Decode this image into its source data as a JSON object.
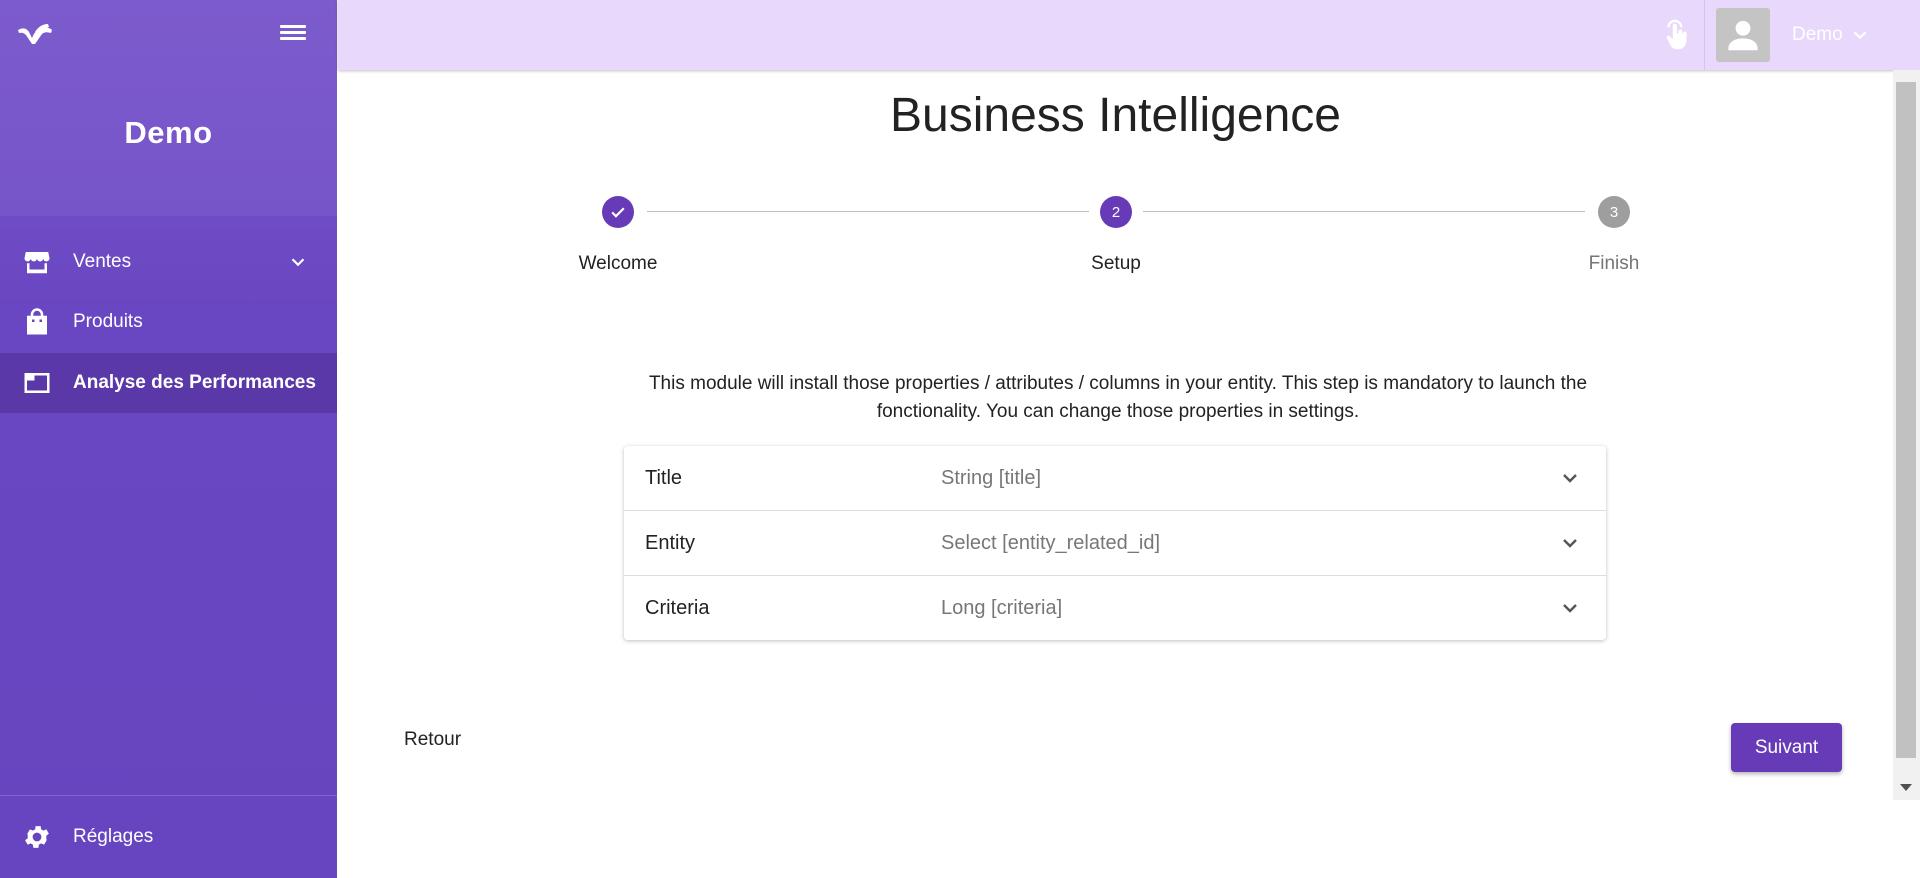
{
  "sidebar": {
    "brand": "Demo",
    "items": [
      {
        "label": "Ventes"
      },
      {
        "label": "Produits"
      },
      {
        "label": "Analyse des Performances"
      }
    ],
    "settings_label": "Réglages"
  },
  "topbar": {
    "user_name": "Demo"
  },
  "main": {
    "title": "Business Intelligence",
    "steps": [
      {
        "number": "1",
        "label": "Welcome",
        "state": "done"
      },
      {
        "number": "2",
        "label": "Setup",
        "state": "active"
      },
      {
        "number": "3",
        "label": "Finish",
        "state": "pending"
      }
    ],
    "intro": "This module will install those properties / attributes / columns in your entity. This step is mandatory to launch the fonctionality. You can change those properties in settings.",
    "fields": [
      {
        "name": "Title",
        "type": "String [title]"
      },
      {
        "name": "Entity",
        "type": "Select [entity_related_id]"
      },
      {
        "name": "Criteria",
        "type": "Long [criteria]"
      }
    ],
    "back_label": "Retour",
    "next_label": "Suivant"
  },
  "colors": {
    "accent": "#673ab7",
    "sidebar": "#6a47c2",
    "topbar": "#e8d8fb",
    "pending_step": "#9e9e9e"
  },
  "icons": {
    "logo": "app-logo",
    "menu": "hamburger-icon",
    "ventes": "store-icon",
    "produits": "shopping-bag-icon",
    "analyse": "window-icon",
    "settings": "gear-icon",
    "touch": "touch-icon",
    "avatar": "person-icon"
  }
}
